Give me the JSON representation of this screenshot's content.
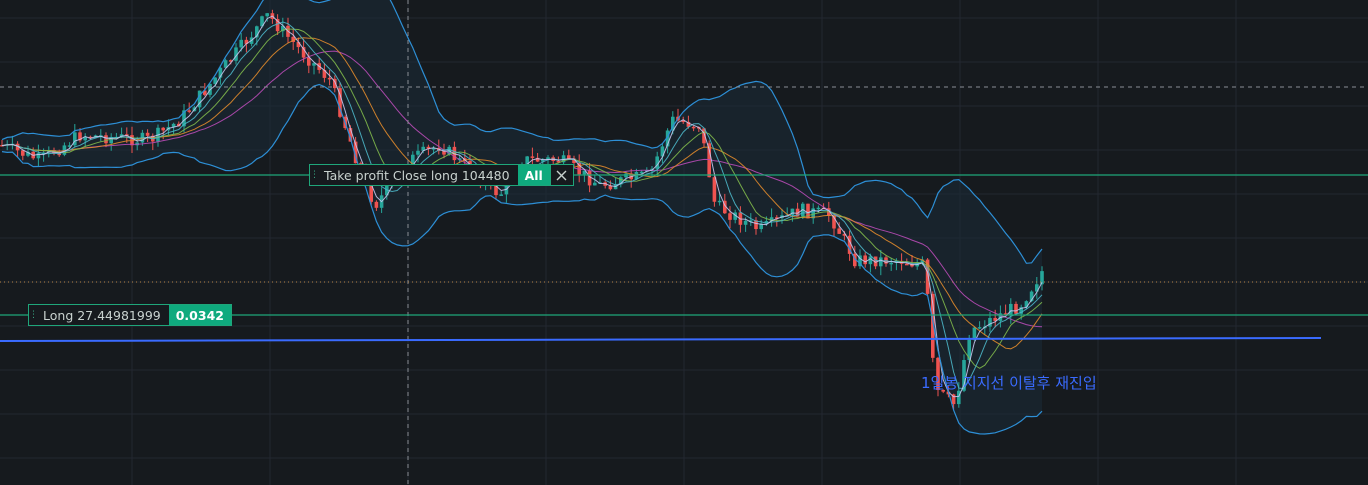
{
  "tp_order": {
    "grip_icon": "grip-dots-icon",
    "label": "Take profit Close long 104480",
    "all_button": "All",
    "close_icon": "close-icon",
    "color": "#1fa67a"
  },
  "long_position": {
    "grip_icon": "grip-dots-icon",
    "label": "Long 27.44981999",
    "pnl": "0.0342",
    "color": "#1fa67a"
  },
  "annotation": {
    "text": "1일봉 지지선 이탈후 재진입",
    "color": "#3a6bff"
  },
  "colors": {
    "background": "#161a1e",
    "grid": "#232830",
    "up_candle": "#26a69a",
    "down_candle": "#ef5350",
    "bollinger": "#2d8fd6",
    "support_line": "#3a6bff",
    "order_line": "#1fa67a",
    "ma_colors": [
      "#b84bb6",
      "#e08a2b",
      "#7fb84b",
      "#4db6c8",
      "#c7c7ee"
    ]
  }
}
